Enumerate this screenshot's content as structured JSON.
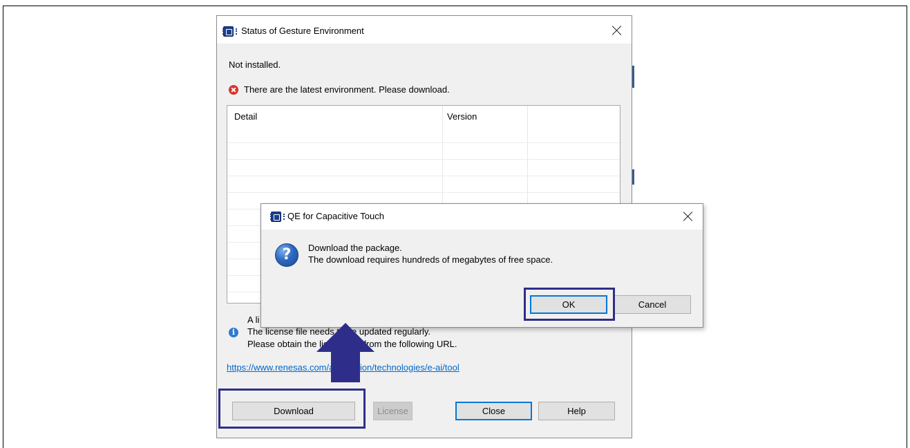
{
  "main_dialog": {
    "title": "Status of Gesture Environment",
    "status_text": "Not installed.",
    "error_message": "There are the latest environment. Please download.",
    "table": {
      "headers": [
        "Detail",
        "Version"
      ],
      "rows": []
    },
    "license_info": {
      "line1": "A li",
      "line2": "The license file needs to be updated regularly.",
      "line3": "Please obtain the license file from the following URL."
    },
    "url": "https://www.renesas.com/application/technologies/e-ai/tool",
    "buttons": {
      "download": "Download",
      "license": "License",
      "close": "Close",
      "help": "Help"
    }
  },
  "confirm_dialog": {
    "title": "QE for Capacitive Touch",
    "message_line1": "Download the package.",
    "message_line2": "The download requires hundreds of megabytes of free space.",
    "buttons": {
      "ok": "OK",
      "cancel": "Cancel"
    }
  },
  "colors": {
    "highlight_border": "#2e2e8a",
    "arrow": "#2e2e8a",
    "default_button_border": "#0078d7",
    "link": "#0066cc",
    "error_icon": "#d9342b",
    "info_icon": "#2f7bd0"
  },
  "icons": {
    "app": "renesas-chip-icon",
    "error": "error-icon",
    "info": "info-icon",
    "question": "question-icon",
    "close": "close-icon",
    "arrow": "up-arrow-icon"
  }
}
